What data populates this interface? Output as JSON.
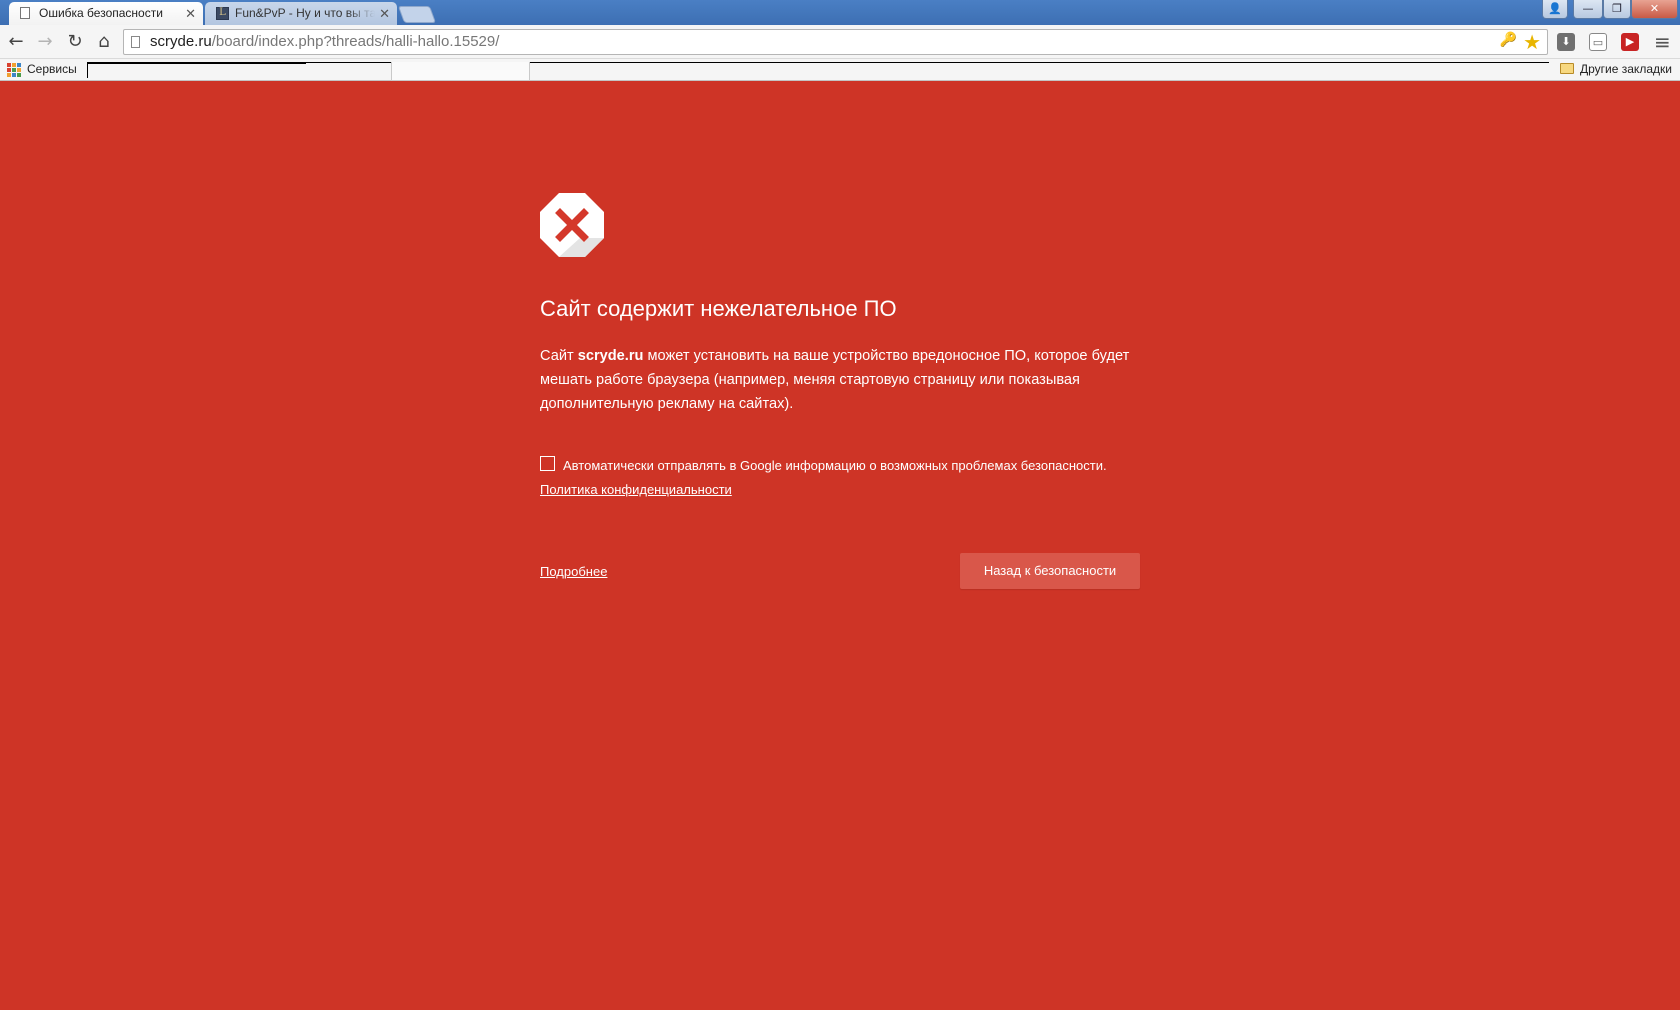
{
  "tabs": [
    {
      "title": "Ошибка безопасности",
      "close": "✕"
    },
    {
      "title": "Fun&PvP - Ну и что вы та",
      "favicon": "L",
      "close": "✕"
    }
  ],
  "window": {
    "user_icon": "👤",
    "min": "—",
    "max": "❐",
    "close": "✕"
  },
  "toolbar": {
    "back_icon": "←",
    "forward_icon": "→",
    "reload_icon": "↻",
    "home_icon": "⌂",
    "url_host": "scryde.ru",
    "url_path": "/board/index.php?threads/halli-hallo.15529/",
    "key_icon": "🔑",
    "star_icon": "★",
    "ext_download_icon": "⬇",
    "ext_cast_icon": "▭",
    "ext_red_icon": "▶",
    "menu_icon": "≡"
  },
  "bookmarks": {
    "services_label": "Сервисы",
    "other_label": "Другие закладки"
  },
  "interstitial": {
    "heading": "Сайт содержит нежелательное ПО",
    "desc_prefix": "Сайт ",
    "desc_site": "scryde.ru",
    "desc_suffix": " может установить на ваше устройство вредоносное ПО, которое будет мешать работе браузера (например, меняя стартовую страницу или показывая дополнительную рекламу на сайтах).",
    "checkbox_label": "Автоматически отправлять в Google информацию о возможных проблемах безопасности.",
    "checkbox_checked": false,
    "privacy_link": "Политика конфиденциальности",
    "details_link": "Подробнее",
    "back_button": "Назад к безопасности"
  },
  "colors": {
    "background": "#ce3426",
    "button": "#d9574a"
  }
}
